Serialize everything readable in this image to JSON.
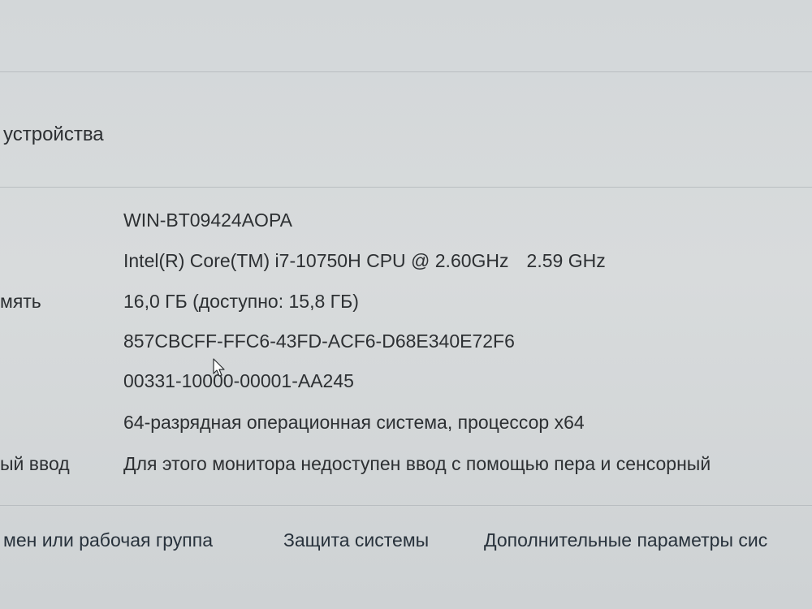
{
  "header": {
    "section_title": "устройства"
  },
  "specs": {
    "device_name": {
      "label": "",
      "value": "WIN-BT09424AOPA"
    },
    "processor": {
      "label": "",
      "value": "Intel(R) Core(TM) i7-10750H CPU @ 2.60GHz",
      "speed": "2.59 GHz"
    },
    "ram": {
      "label": "мять",
      "value": "16,0 ГБ (доступно: 15,8 ГБ)"
    },
    "device_id": {
      "label": "",
      "value": "857CBCFF-FFC6-43FD-ACF6-D68E340E72F6"
    },
    "product_id": {
      "label": "",
      "value": "00331-10000-00001-AA245"
    },
    "system_type": {
      "label": "",
      "value": "64-разрядная операционная система, процессор x64"
    },
    "pen_touch": {
      "label": "ый ввод",
      "value": "Для этого монитора недоступен ввод с помощью пера и сенсорный"
    }
  },
  "links": {
    "domain_workgroup": "мен или рабочая группа",
    "system_protection": "Защита системы",
    "advanced_settings": "Дополнительные параметры сис"
  }
}
